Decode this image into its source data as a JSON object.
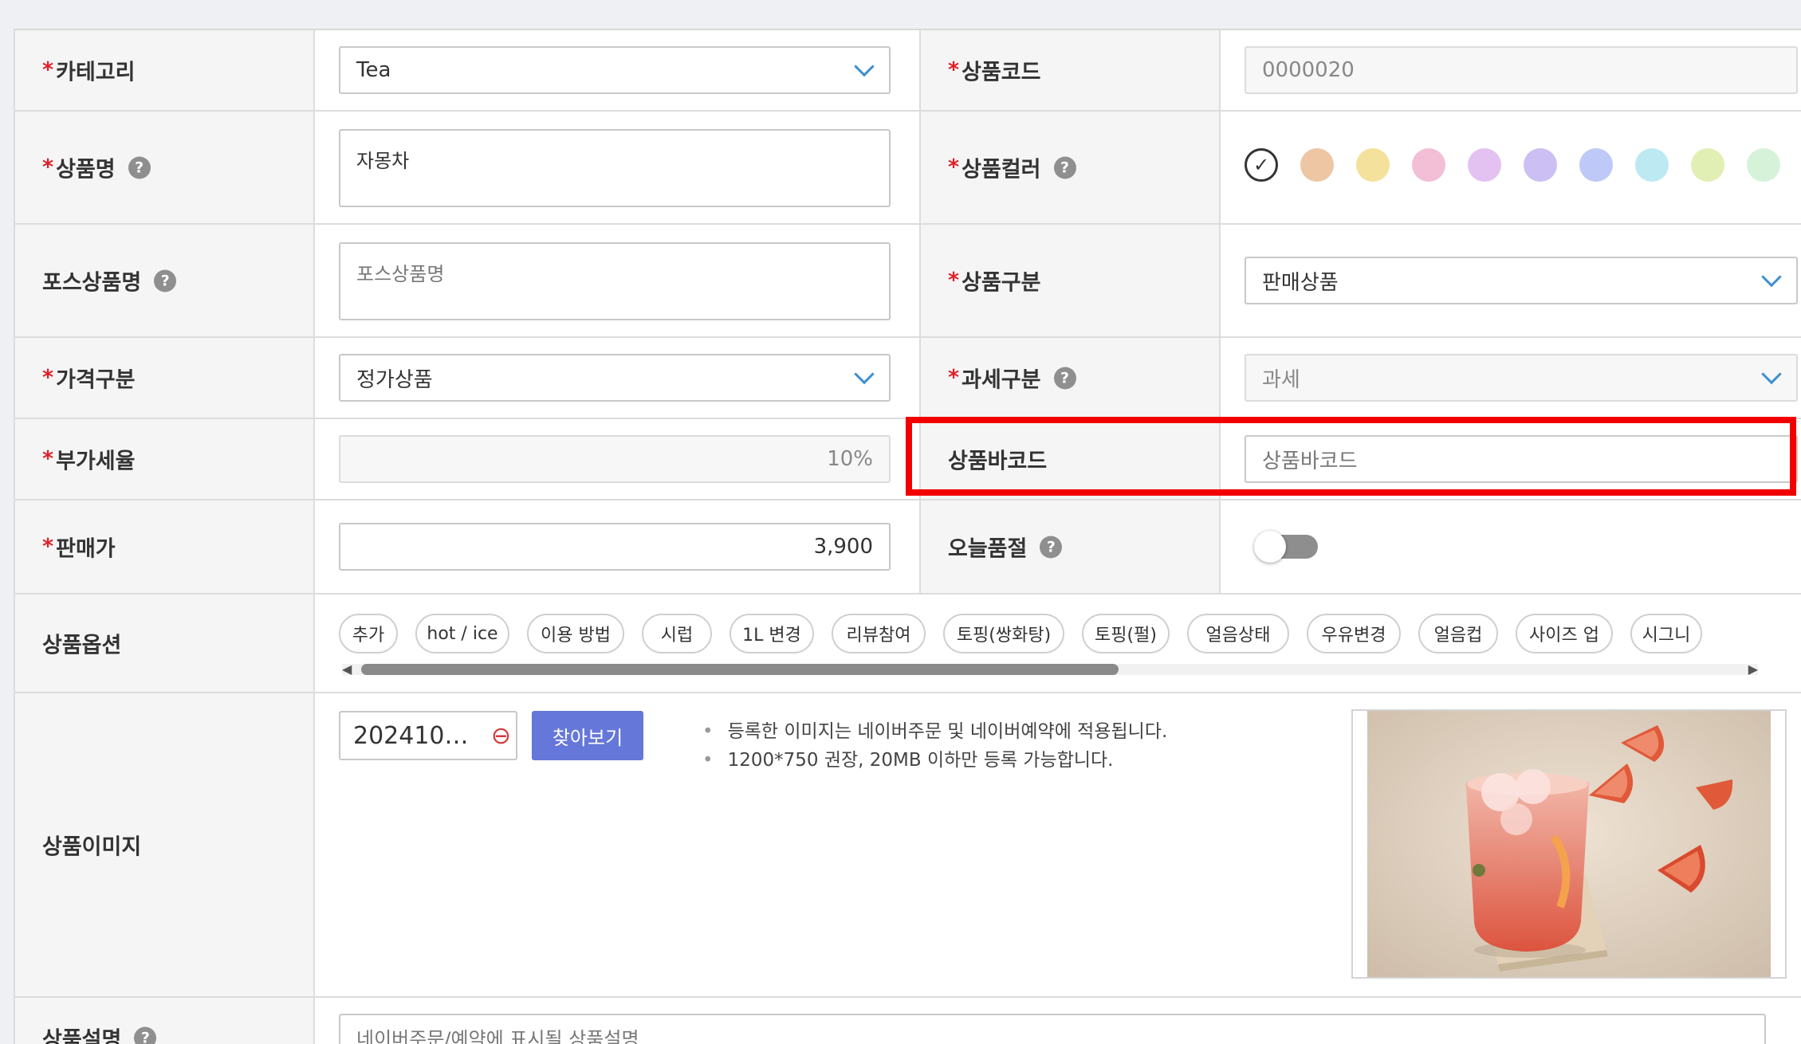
{
  "form": {
    "required_mark": "*",
    "help_glyph": "?",
    "category": {
      "label": "카테고리",
      "value": "Tea"
    },
    "product_code": {
      "label": "상품코드",
      "value": "0000020"
    },
    "product_name": {
      "label": "상품명",
      "value": "자몽차"
    },
    "product_color": {
      "label": "상품컬러",
      "selected_glyph": "✓",
      "colors": [
        "#eec6a4",
        "#f4e19c",
        "#f2bfd6",
        "#e3c2f2",
        "#cbbff4",
        "#bfc9f7",
        "#bde9f3",
        "#e1efb4",
        "#d6f2d8"
      ]
    },
    "pos_name": {
      "label": "포스상품명",
      "placeholder": "포스상품명"
    },
    "product_type": {
      "label": "상품구분",
      "value": "판매상품"
    },
    "price_type": {
      "label": "가격구분",
      "value": "정가상품"
    },
    "tax_type": {
      "label": "과세구분",
      "value": "과세"
    },
    "vat_rate": {
      "label": "부가세율",
      "value": "10%"
    },
    "barcode": {
      "label": "상품바코드",
      "placeholder": "상품바코드"
    },
    "sale_price": {
      "label": "판매가",
      "value": "3,900"
    },
    "sold_out_today": {
      "label": "오늘품절",
      "enabled": false
    },
    "options": {
      "label": "상품옵션",
      "chips": [
        "추가",
        "hot / ice",
        "이용 방법",
        "시럽",
        "1L 변경",
        "리뷰참여",
        "토핑(쌍화탕)",
        "토핑(펄)",
        "얼음상태",
        "우유변경",
        "얼음컵",
        "사이즈 업",
        "시그니"
      ],
      "scroll_left": "◀",
      "scroll_right": "▶"
    },
    "image": {
      "label": "상품이미지",
      "file_name": "202410…",
      "remove_glyph": "⊖",
      "browse_button": "찾아보기",
      "notes": [
        "등록한 이미지는 네이버주문 및 네이버예약에 적용됩니다.",
        "1200*750 권장, 20MB 이하만 등록 가능합니다."
      ]
    },
    "description": {
      "label": "상품설명",
      "placeholder": "네이버주문/예약에 표시될 상품설명"
    }
  },
  "colors": {
    "accent": "#6577d9",
    "highlight": "#f20000",
    "chevron": "#3d8fd1"
  }
}
